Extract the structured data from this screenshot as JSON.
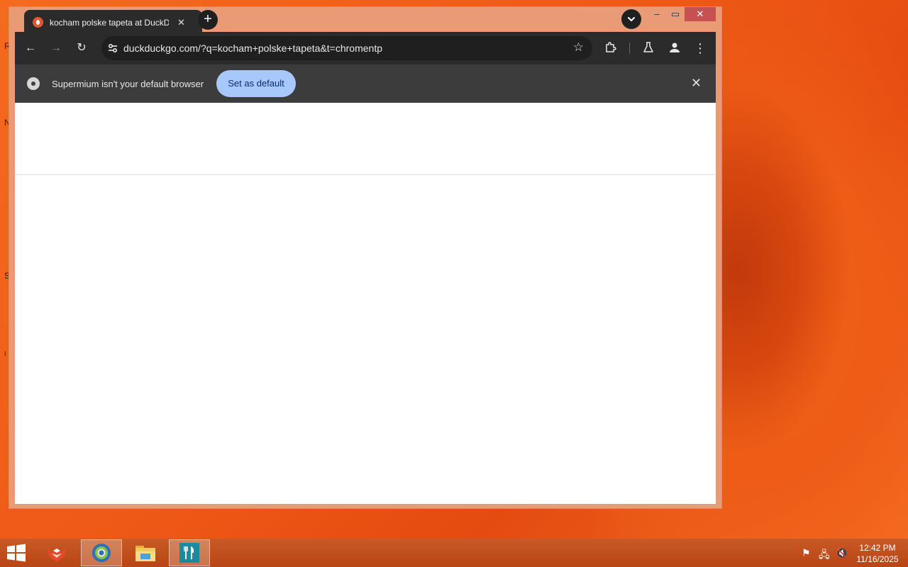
{
  "desktop": {
    "edge_letters": [
      "R",
      "N",
      "S",
      "I"
    ]
  },
  "browser": {
    "tab": {
      "title": "kocham polske tapeta at DuckD",
      "close_glyph": "✕",
      "favicon": "duckduckgo-icon"
    },
    "new_tab_glyph": "+",
    "window_controls": {
      "minimize": "–",
      "maximize": "▭",
      "close": "✕"
    },
    "toolbar": {
      "back": "←",
      "forward": "→",
      "reload": "↻",
      "url": "duckduckgo.com/?q=kocham+polske+tapeta&t=chromentp",
      "bookmark_star": "☆",
      "extensions_icon": "puzzle-icon",
      "labs_icon": "flask-icon",
      "profile_icon": "person-icon",
      "menu_glyph": "⋮"
    },
    "infobar": {
      "message": "Supermium isn't your default browser",
      "button": "Set as default",
      "close_glyph": "✕"
    }
  },
  "taskbar": {
    "items": [
      {
        "name": "app-fox-icon"
      },
      {
        "name": "browser-icon",
        "active": true
      },
      {
        "name": "file-explorer-icon"
      },
      {
        "name": "utensils-app-icon"
      }
    ],
    "clock": {
      "time": "12:42 PM",
      "date": "11/16/2025"
    }
  },
  "colors": {
    "accent_button": "#a8c7fa",
    "toolbar": "#2b2b2b",
    "infobar": "#3c3c3c",
    "window_frame": "#e99b76",
    "close_button": "#c75050"
  }
}
